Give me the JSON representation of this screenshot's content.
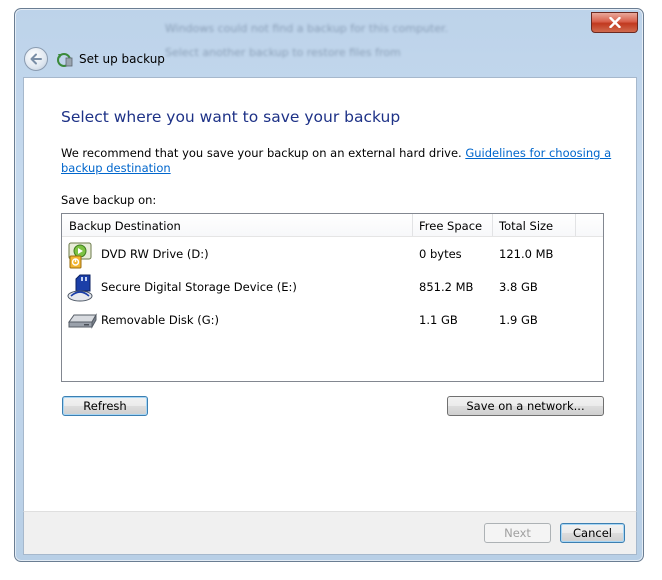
{
  "titlebar": {
    "background_lines": [
      "Windows could not find a backup for this computer.",
      "Select another backup to restore files from"
    ]
  },
  "nav": {
    "title": "Set up backup"
  },
  "main": {
    "heading": "Select where you want to save your backup",
    "description": "We recommend that you save your backup on an external hard drive. ",
    "link_text": "Guidelines for choosing a backup destination",
    "save_on_label": "Save backup on:"
  },
  "destinations": {
    "columns": [
      "Backup Destination",
      "Free Space",
      "Total Size"
    ],
    "rows": [
      {
        "name": "DVD RW Drive (D:)",
        "free": "0 bytes",
        "total": "121.0 MB",
        "icon": "dvd-drive-icon"
      },
      {
        "name": "Secure Digital Storage Device (E:)",
        "free": "851.2 MB",
        "total": "3.8 GB",
        "icon": "sd-card-icon"
      },
      {
        "name": "Removable Disk (G:)",
        "free": "1.1 GB",
        "total": "1.9 GB",
        "icon": "removable-disk-icon"
      }
    ]
  },
  "buttons": {
    "refresh": "Refresh",
    "save_network": "Save on a network...",
    "next": "Next",
    "cancel": "Cancel"
  },
  "colors": {
    "heading": "#1e3287",
    "link": "#0066cc",
    "close": "#c1391f"
  }
}
